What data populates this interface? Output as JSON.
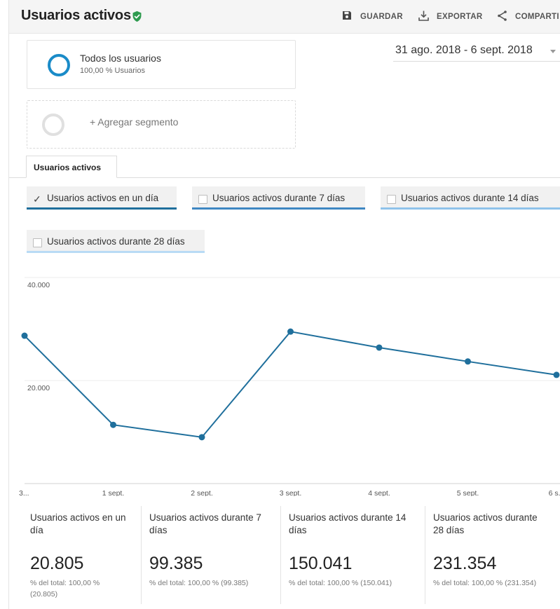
{
  "header": {
    "title": "Usuarios activos",
    "save_label": "GUARDAR",
    "export_label": "EXPORTAR",
    "share_label": "COMPARTI"
  },
  "segment": {
    "name": "Todos los usuarios",
    "subtitle": "100,00 % Usuarios",
    "add_label": "+ Agregar segmento"
  },
  "date_range": "31 ago. 2018 - 6 sept. 2018",
  "tab": {
    "label": "Usuarios activos"
  },
  "metric_chips": [
    {
      "label": "Usuarios activos en un día",
      "checked": true,
      "color": "#1f6f9c"
    },
    {
      "label": "Usuarios activos durante 7 días",
      "checked": false,
      "color": "#3f87c2"
    },
    {
      "label": "Usuarios activos durante 14 días",
      "checked": false,
      "color": "#8fc2ea"
    },
    {
      "label": "Usuarios activos durante 28 días",
      "checked": false,
      "color": "#b9dbf5"
    }
  ],
  "chart_data": {
    "type": "line",
    "categories": [
      "3...",
      "1 sept.",
      "2 sept.",
      "3 sept.",
      "4 sept.",
      "5 sept.",
      "6 s..."
    ],
    "series": [
      {
        "values": [
          28700,
          11400,
          9000,
          29500,
          26400,
          23700,
          21100
        ],
        "color": "#1f6f9c"
      }
    ],
    "yticks": [
      "40.000",
      "20.000"
    ],
    "ytick_values": [
      40000,
      20000
    ],
    "ylim": [
      0,
      40000
    ],
    "grid": true
  },
  "scorecards": [
    {
      "name": "Usuarios activos en un día",
      "value": "20.805",
      "pct": "% del total: 100,00 % (20.805)"
    },
    {
      "name": "Usuarios activos durante 7 días",
      "value": "99.385",
      "pct": "% del total: 100,00 % (99.385)"
    },
    {
      "name": "Usuarios activos durante 14 días",
      "value": "150.041",
      "pct": "% del total: 100,00 % (150.041)"
    },
    {
      "name": "Usuarios activos durante 28 días",
      "value": "231.354",
      "pct": "% del total: 100,00 % (231.354)"
    }
  ],
  "colors": {
    "verified": "#2e9b4f",
    "segment_ring": "#1a8bc8",
    "add_ring": "#e0e0e0"
  },
  "icons": {
    "verified": "check-shield-icon",
    "save": "floppy-disk-icon",
    "export": "download-tray-icon",
    "share": "share-nodes-icon"
  }
}
